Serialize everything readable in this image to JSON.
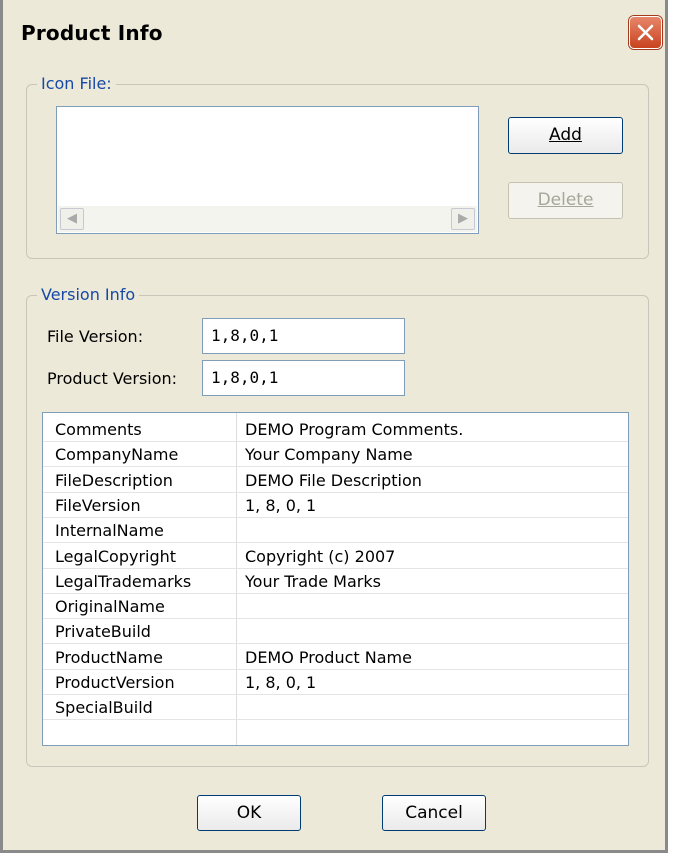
{
  "window": {
    "title": "Product Info"
  },
  "icon_group": {
    "legend": "Icon File:",
    "add_label": "Add",
    "delete_label": "Delete"
  },
  "version_group": {
    "legend": "Version Info",
    "file_version_label": "File Version:",
    "file_version_value": "1,8,0,1",
    "product_version_label": "Product Version:",
    "product_version_value": "1,8,0,1"
  },
  "properties": [
    {
      "name": "Comments",
      "value": "DEMO Program Comments."
    },
    {
      "name": "CompanyName",
      "value": "Your Company Name"
    },
    {
      "name": "FileDescription",
      "value": "DEMO File Description"
    },
    {
      "name": "FileVersion",
      "value": "1, 8, 0, 1"
    },
    {
      "name": "InternalName",
      "value": ""
    },
    {
      "name": "LegalCopyright",
      "value": "Copyright (c) 2007"
    },
    {
      "name": "LegalTrademarks",
      "value": "Your Trade Marks"
    },
    {
      "name": "OriginalName",
      "value": ""
    },
    {
      "name": "PrivateBuild",
      "value": ""
    },
    {
      "name": "ProductName",
      "value": "DEMO Product Name"
    },
    {
      "name": "ProductVersion",
      "value": "1, 8, 0, 1"
    },
    {
      "name": "SpecialBuild",
      "value": ""
    }
  ],
  "footer": {
    "ok_label": "OK",
    "cancel_label": "Cancel"
  }
}
